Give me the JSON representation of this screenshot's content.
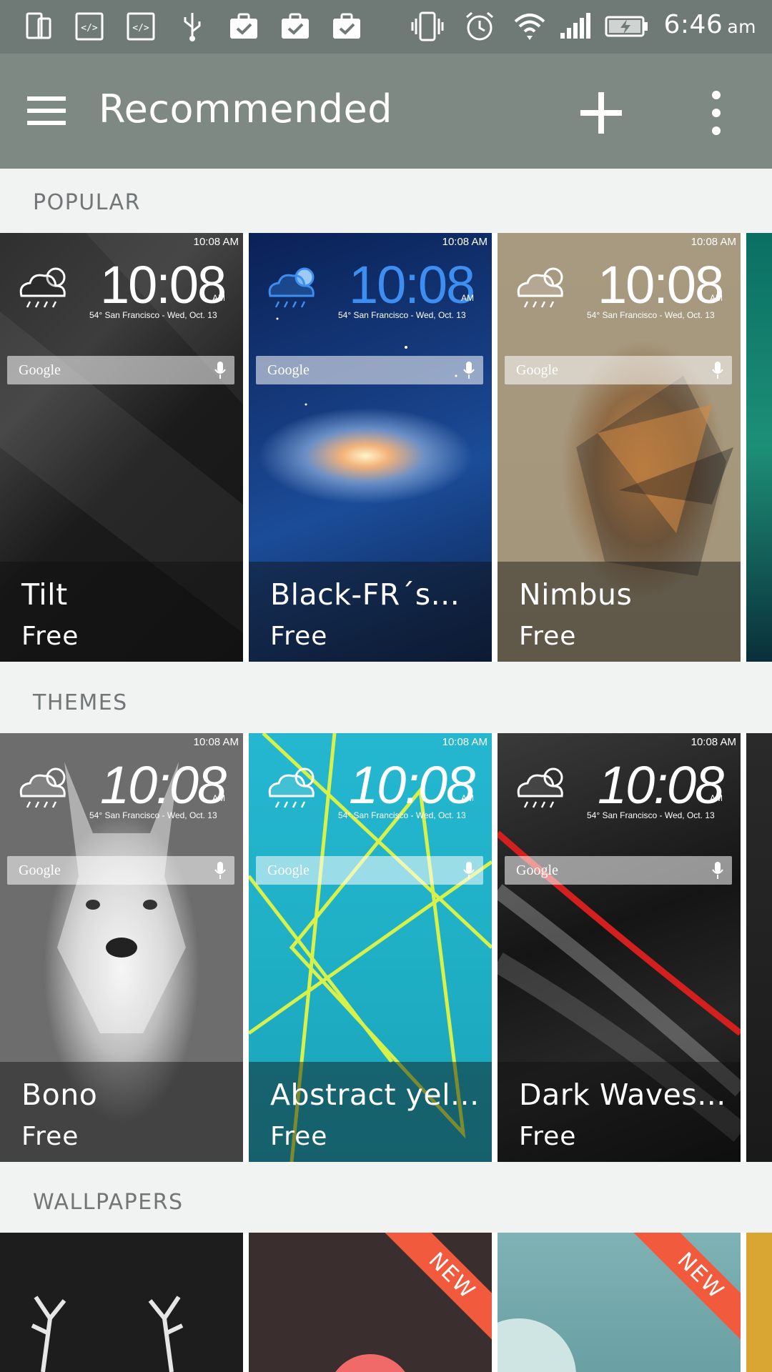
{
  "status_bar": {
    "time": "6:46",
    "ampm": "am",
    "icons": [
      "phone-screen-icon",
      "code-icon",
      "code-icon",
      "usb-icon",
      "briefcase-check-icon",
      "briefcase-check-icon",
      "briefcase-check-icon",
      "vibrate-icon",
      "alarm-icon",
      "wifi-icon",
      "signal-icon",
      "battery-charging-icon"
    ]
  },
  "app_bar": {
    "title": "Recommended",
    "menu_icon": "hamburger-menu-icon",
    "add_icon": "plus-icon",
    "more_icon": "more-vertical-icon"
  },
  "sections": {
    "popular": {
      "label": "POPULAR",
      "cards": [
        {
          "title": "Tilt",
          "price": "Free"
        },
        {
          "title": "Black-FR´s...",
          "price": "Free"
        },
        {
          "title": "Nimbus",
          "price": "Free"
        }
      ]
    },
    "themes": {
      "label": "THEMES",
      "cards": [
        {
          "title": "Bono",
          "price": "Free"
        },
        {
          "title": "Abstract yel...",
          "price": "Free"
        },
        {
          "title": "Dark Waves...",
          "price": "Free"
        }
      ]
    },
    "wallpapers": {
      "label": "WALLPAPERS",
      "cards": [
        {
          "badge": ""
        },
        {
          "badge": "NEW"
        },
        {
          "badge": "NEW"
        }
      ]
    }
  },
  "preview": {
    "mini_status_time": "10:08 AM",
    "clock": "10:08",
    "clock_ampm": "AM",
    "clock_sub": "54° San Francisco - Wed, Oct. 13",
    "search_label": "Google"
  },
  "colors": {
    "status_bar": "#6f7a76",
    "app_bar": "#7e8984",
    "section_bg": "#f1f2f2",
    "badge": "#f15a3c",
    "accent_blue_clock": "#3d8ef0"
  }
}
